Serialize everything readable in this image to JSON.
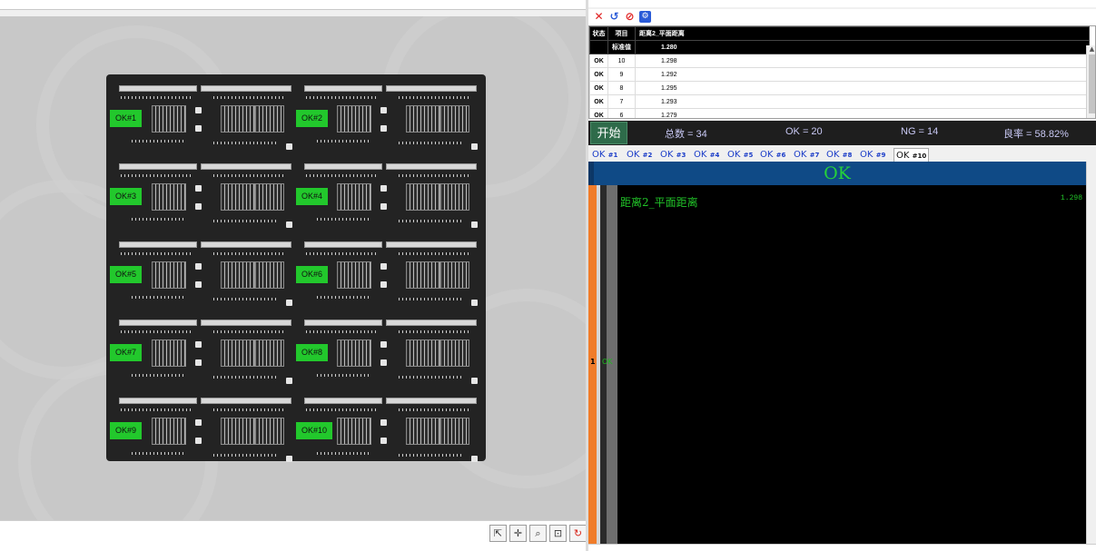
{
  "viewer": {
    "labels": [
      "OK#1",
      "OK#2",
      "OK#3",
      "OK#4",
      "OK#5",
      "OK#6",
      "OK#7",
      "OK#8",
      "OK#9",
      "OK#10"
    ],
    "label_color": "#22c82c",
    "tools": [
      "export-icon",
      "crosshair-icon",
      "zoom-in-icon",
      "zoom-fit-icon",
      "refresh-icon"
    ]
  },
  "toolbar": {
    "icons": [
      "close-icon",
      "reset-icon",
      "stop-icon",
      "settings-icon"
    ]
  },
  "table": {
    "headers": [
      "状态",
      "项目",
      "距离2_平面距离"
    ],
    "standard": {
      "label": "标准值",
      "value": "1.280"
    },
    "rows": [
      {
        "status": "OK",
        "item": "10",
        "value": "1.298"
      },
      {
        "status": "OK",
        "item": "9",
        "value": "1.292"
      },
      {
        "status": "OK",
        "item": "8",
        "value": "1.295"
      },
      {
        "status": "OK",
        "item": "7",
        "value": "1.293"
      },
      {
        "status": "OK",
        "item": "6",
        "value": "1.279"
      }
    ]
  },
  "stats": {
    "start_label": "开始",
    "total": "总数 = 34",
    "ok": "OK = 20",
    "ng": "NG = 14",
    "rate": "良率 = 58.82%"
  },
  "tabs": [
    {
      "prefix": "OK",
      "num": "#1"
    },
    {
      "prefix": "OK",
      "num": "#2"
    },
    {
      "prefix": "OK",
      "num": "#3"
    },
    {
      "prefix": "OK",
      "num": "#4"
    },
    {
      "prefix": "OK",
      "num": "#5"
    },
    {
      "prefix": "OK",
      "num": "#6"
    },
    {
      "prefix": "OK",
      "num": "#7"
    },
    {
      "prefix": "OK",
      "num": "#8"
    },
    {
      "prefix": "OK",
      "num": "#9"
    },
    {
      "prefix": "OK",
      "num": "#10"
    }
  ],
  "active_tab": 9,
  "result": {
    "banner": "OK",
    "row_index": "1",
    "row_status": "OK",
    "item_name": "距离2_平面距离",
    "item_value": "1.298"
  },
  "colors": {
    "ok_green": "#25d23a",
    "banner_bg": "#0f4a86",
    "accent_orange": "#f07c2a"
  }
}
